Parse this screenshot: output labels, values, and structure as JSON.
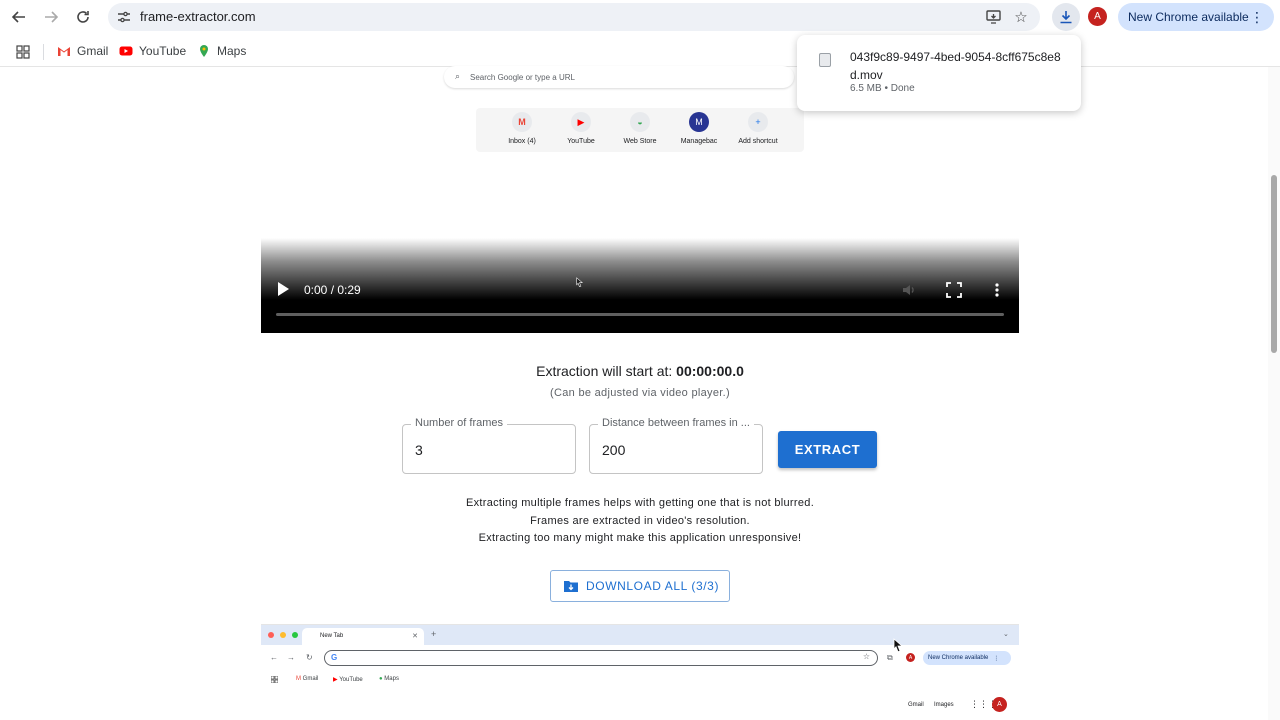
{
  "browser": {
    "url": "frame-extractor.com",
    "profile_initial": "A",
    "update_label": "New Chrome available",
    "bookmarks": [
      {
        "label": "Gmail"
      },
      {
        "label": "YouTube"
      },
      {
        "label": "Maps"
      }
    ]
  },
  "download_popup": {
    "filename": "043f9c89-9497-4bed-9054-8cff675c8e8d.mov",
    "meta": "6.5 MB • Done"
  },
  "video_frame": {
    "search_placeholder": "Search Google or type a URL",
    "shortcuts": [
      {
        "label": "Inbox (4)",
        "icon": "M"
      },
      {
        "label": "YouTube",
        "icon": "▶"
      },
      {
        "label": "Web Store",
        "icon": "◒"
      },
      {
        "label": "Managebac",
        "icon": "M"
      },
      {
        "label": "Add shortcut",
        "icon": "+"
      }
    ]
  },
  "player": {
    "time": "0:00 / 0:29",
    "progress": 0.0
  },
  "extraction": {
    "label": "Extraction will start at:",
    "start_time": "00:00:00.0",
    "note": "(Can be adjusted via video player.)",
    "frames_label": "Number of frames",
    "frames_value": "3",
    "distance_label": "Distance between frames in ...",
    "distance_value": "200",
    "extract_label": "EXTRACT",
    "info_lines": [
      "Extracting multiple frames helps with getting one that is not blurred.",
      "Frames are extracted in video's resolution.",
      "Extracting too many might make this application unresponsive!"
    ],
    "download_all_label": "DOWNLOAD ALL (3/3)"
  },
  "preview": {
    "tab_title": "New Tab",
    "update_label": "New Chrome available",
    "bookmarks": [
      "Gmail",
      "YouTube",
      "Maps"
    ],
    "right_links": [
      "Gmail",
      "Images"
    ],
    "profile_initial": "A"
  },
  "colors": {
    "accent": "#1e6fd0",
    "update_pill": "#d3e3fd",
    "avatar": "#c5221f"
  }
}
